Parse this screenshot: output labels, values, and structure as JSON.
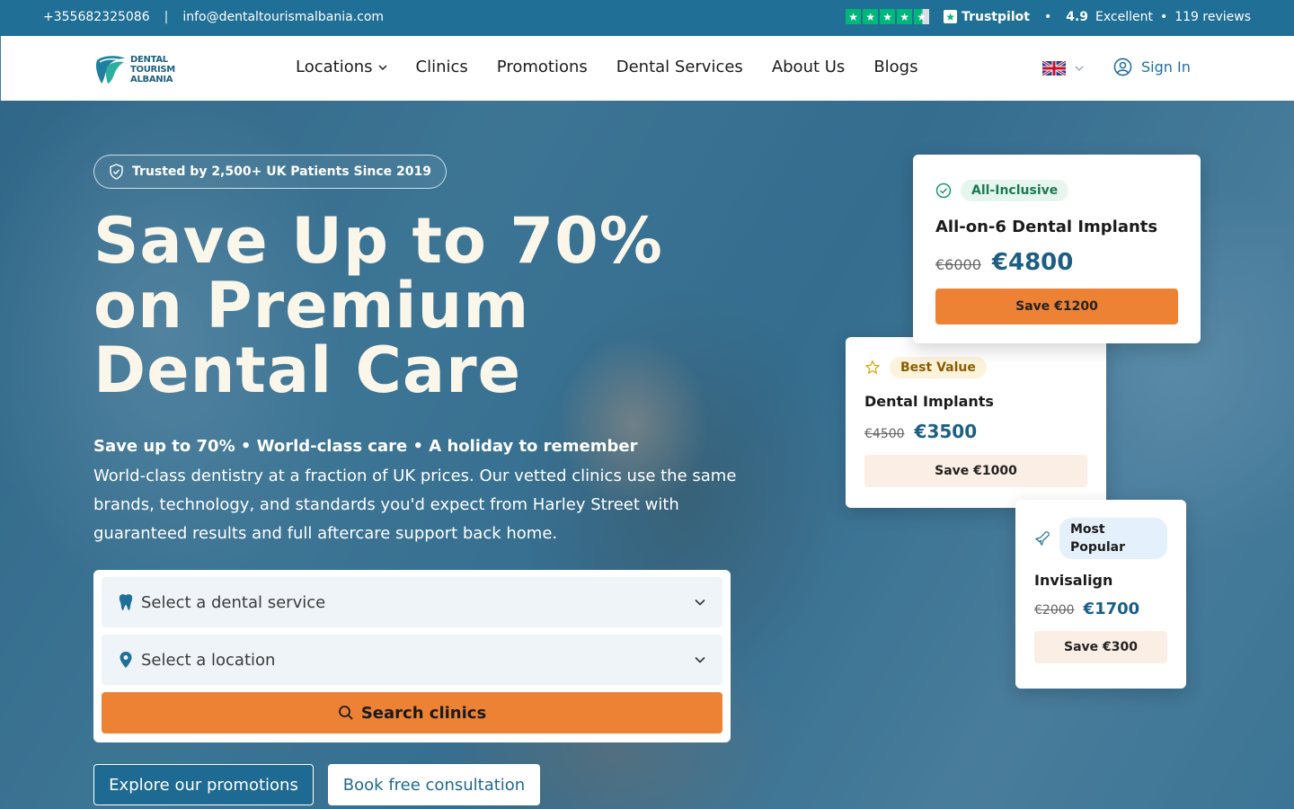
{
  "topbar": {
    "phone": "+355682325086",
    "separator": "|",
    "email": "info@dentaltourismalbania.com",
    "trustpilot_label": "Trustpilot",
    "bullet": "•",
    "score": "4.9",
    "score_word": "Excellent",
    "reviews": "119 reviews",
    "stars_value": 4.5
  },
  "nav": {
    "logo_lines": [
      "DENTAL",
      "TOURISM",
      "ALBANIA"
    ],
    "items": [
      {
        "label": "Locations",
        "has_dropdown": true
      },
      {
        "label": "Clinics"
      },
      {
        "label": "Promotions"
      },
      {
        "label": "Dental Services"
      },
      {
        "label": "About Us"
      },
      {
        "label": "Blogs"
      }
    ],
    "language_icon": "uk-flag-icon",
    "sign_in": "Sign In"
  },
  "hero": {
    "trust_badge": "Trusted by 2,500+ UK Patients Since 2019",
    "headline": "Save Up to 70% on Premium Dental Care",
    "tagline": "Save up to 70% • World-class care • A holiday to remember",
    "description": "World-class dentistry at a fraction of UK prices. Our vetted clinics use the same brands, technology, and standards you'd expect from Harley Street with guaranteed results and full aftercare support back home.",
    "search": {
      "service_placeholder": "Select a dental service",
      "location_placeholder": "Select a location",
      "button": "Search clinics"
    },
    "cta_primary": "Explore our promotions",
    "cta_secondary": "Book free consultation"
  },
  "offers": [
    {
      "badge": "All-Inclusive",
      "title": "All-on-6 Dental Implants",
      "old_price": "€6000",
      "new_price": "€4800",
      "save": "Save €1200",
      "icon": "check-circle-icon"
    },
    {
      "badge": "Best Value",
      "title": "Dental Implants",
      "old_price": "€4500",
      "new_price": "€3500",
      "save": "Save €1000",
      "icon": "star-icon"
    },
    {
      "badge": "Most Popular",
      "title": "Invisalign",
      "old_price": "€2000",
      "new_price": "€1700",
      "save": "Save €300",
      "icon": "plane-icon"
    }
  ],
  "colors": {
    "brand_blue": "#1f6f96",
    "accent_orange": "#ee8234",
    "trustpilot_green": "#00b67a"
  }
}
